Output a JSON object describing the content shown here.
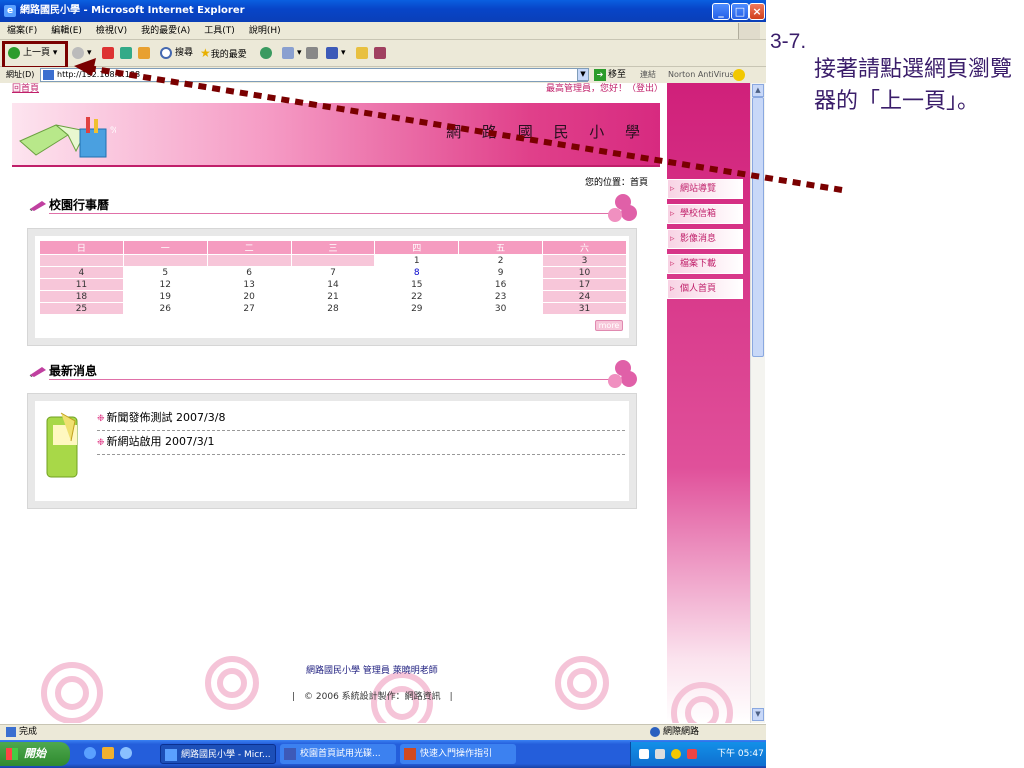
{
  "window": {
    "title": "網路國民小學 - Microsoft Internet Explorer"
  },
  "menubar": {
    "items": [
      "檔案(F)",
      "編輯(E)",
      "檢視(V)",
      "我的最愛(A)",
      "工具(T)",
      "說明(H)"
    ]
  },
  "toolbar": {
    "back": "上一頁",
    "search": "搜尋",
    "favorites": "我的最愛"
  },
  "address": {
    "label": "網址(D)",
    "url": "http://192.168.0.108",
    "go": "移至",
    "links": "連結",
    "norton": "Norton AntiVirus"
  },
  "page": {
    "home_link": "回首頁",
    "greeting": "最高管理員，您好！（登出）",
    "school_name": "網 路 國 民 小 學",
    "location": "您的位置：首頁",
    "calendar_title": "校園行事曆",
    "news_title": "最新消息",
    "more": "more",
    "calendar": {
      "headers": [
        "日",
        "一",
        "二",
        "三",
        "四",
        "五",
        "六"
      ],
      "weeks": [
        [
          "",
          "",
          "",
          "",
          "1",
          "2",
          "3"
        ],
        [
          "4",
          "5",
          "6",
          "7",
          "8",
          "9",
          "10"
        ],
        [
          "11",
          "12",
          "13",
          "14",
          "15",
          "16",
          "17"
        ],
        [
          "18",
          "19",
          "20",
          "21",
          "22",
          "23",
          "24"
        ],
        [
          "25",
          "26",
          "27",
          "28",
          "29",
          "30",
          "31"
        ]
      ]
    },
    "news": [
      {
        "title": "新聞發佈測試 2007/3/8"
      },
      {
        "title": "新網站啟用 2007/3/1"
      }
    ],
    "nav": [
      "網站導覽",
      "學校信箱",
      "影像消息",
      "檔案下載",
      "個人首頁"
    ],
    "footer_line1": "網路國民小學 管理員 萊曉明老師",
    "footer_line2": "|　© 2006 系統設計製作：網路資訊　|"
  },
  "statusbar": {
    "status": "完成",
    "zone": "網際網路"
  },
  "taskbar": {
    "start": "開始",
    "tasks": [
      "網路國民小學 - Micr...",
      "校園首頁試用光碟...",
      "快速入門操作指引"
    ],
    "clock": "下午 05:47"
  },
  "annotation": {
    "step": "3-7.",
    "text": "接著請點選網頁瀏覽器的「上一頁」。"
  },
  "colors": {
    "brand_pink": "#d72a80",
    "annotation": "#3a1d6a",
    "arrow": "#7a0000"
  }
}
